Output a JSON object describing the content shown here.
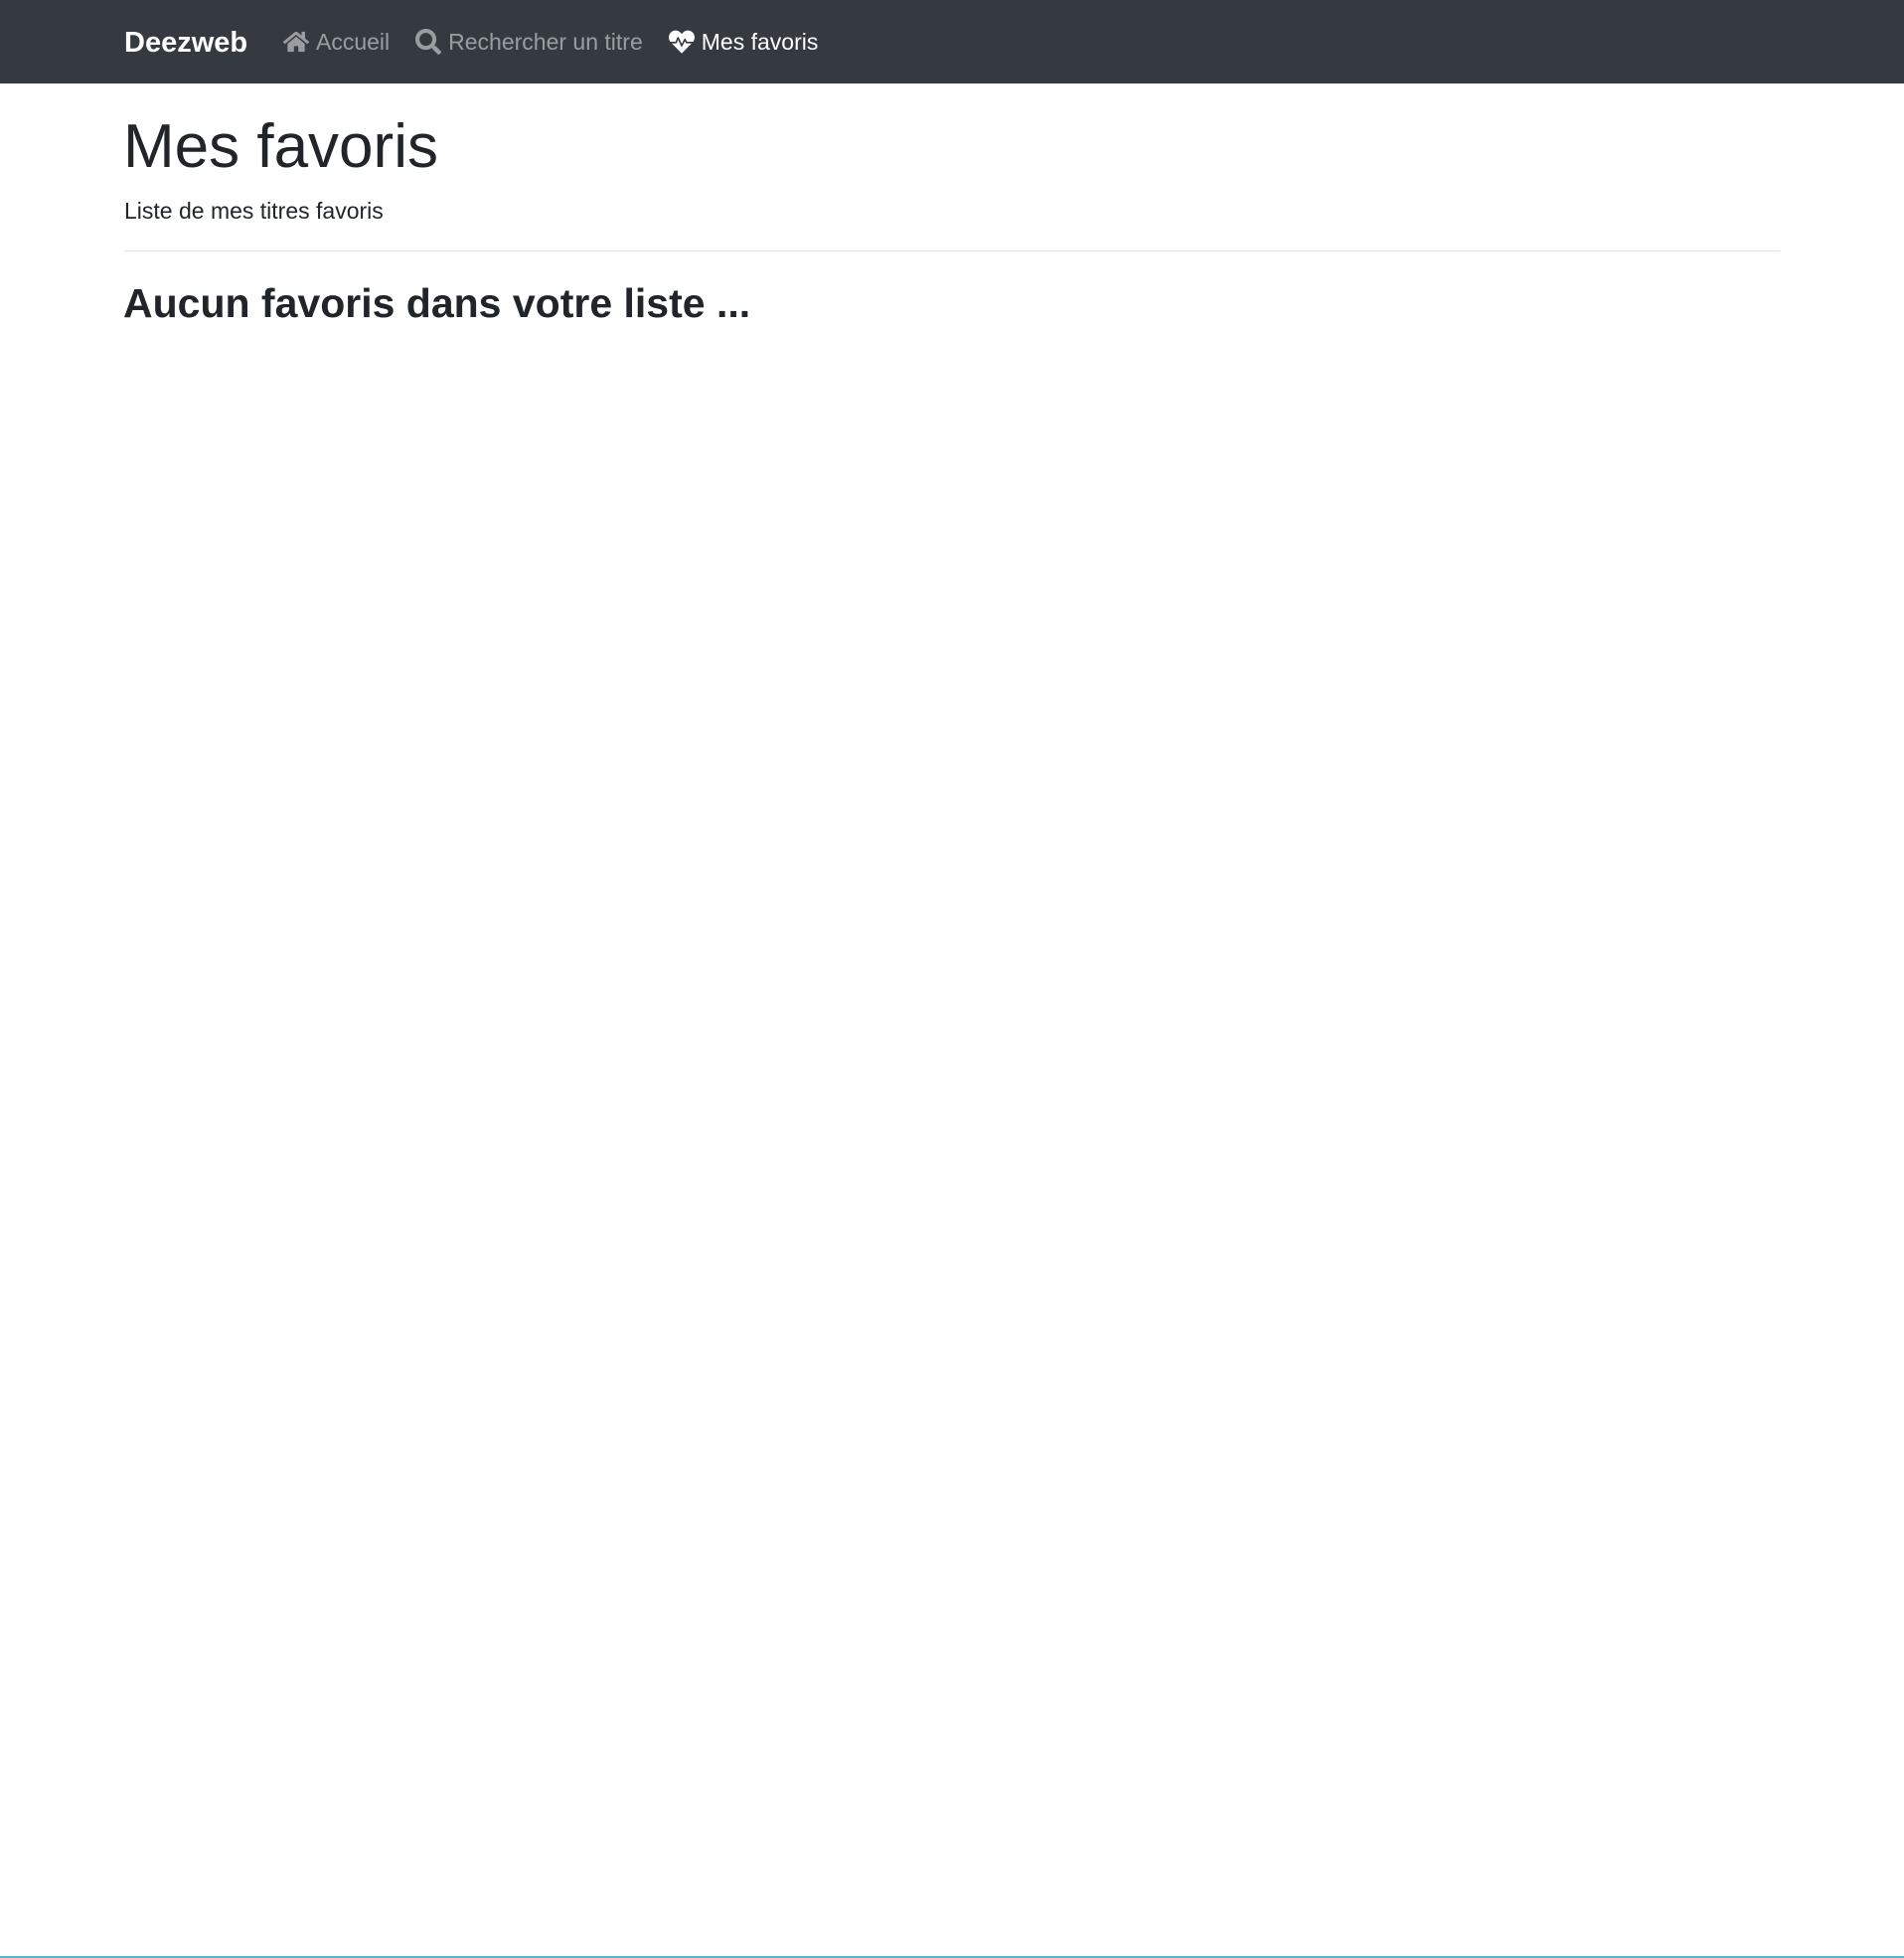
{
  "navbar": {
    "brand": "Deezweb",
    "items": [
      {
        "label": "Accueil",
        "icon": "home-icon",
        "active": false
      },
      {
        "label": "Rechercher un titre",
        "icon": "search-icon",
        "active": false
      },
      {
        "label": "Mes favoris",
        "icon": "heartbeat-icon",
        "active": true
      }
    ]
  },
  "header": {
    "title": "Mes favoris",
    "subtitle": "Liste de mes titres favoris"
  },
  "main": {
    "empty_message": "Aucun favoris dans votre liste ..."
  },
  "colors": {
    "navbar_bg": "#343a40",
    "nav_link_inactive": "rgba(255,255,255,0.5)",
    "nav_link_active": "#ffffff",
    "text": "#212529"
  }
}
